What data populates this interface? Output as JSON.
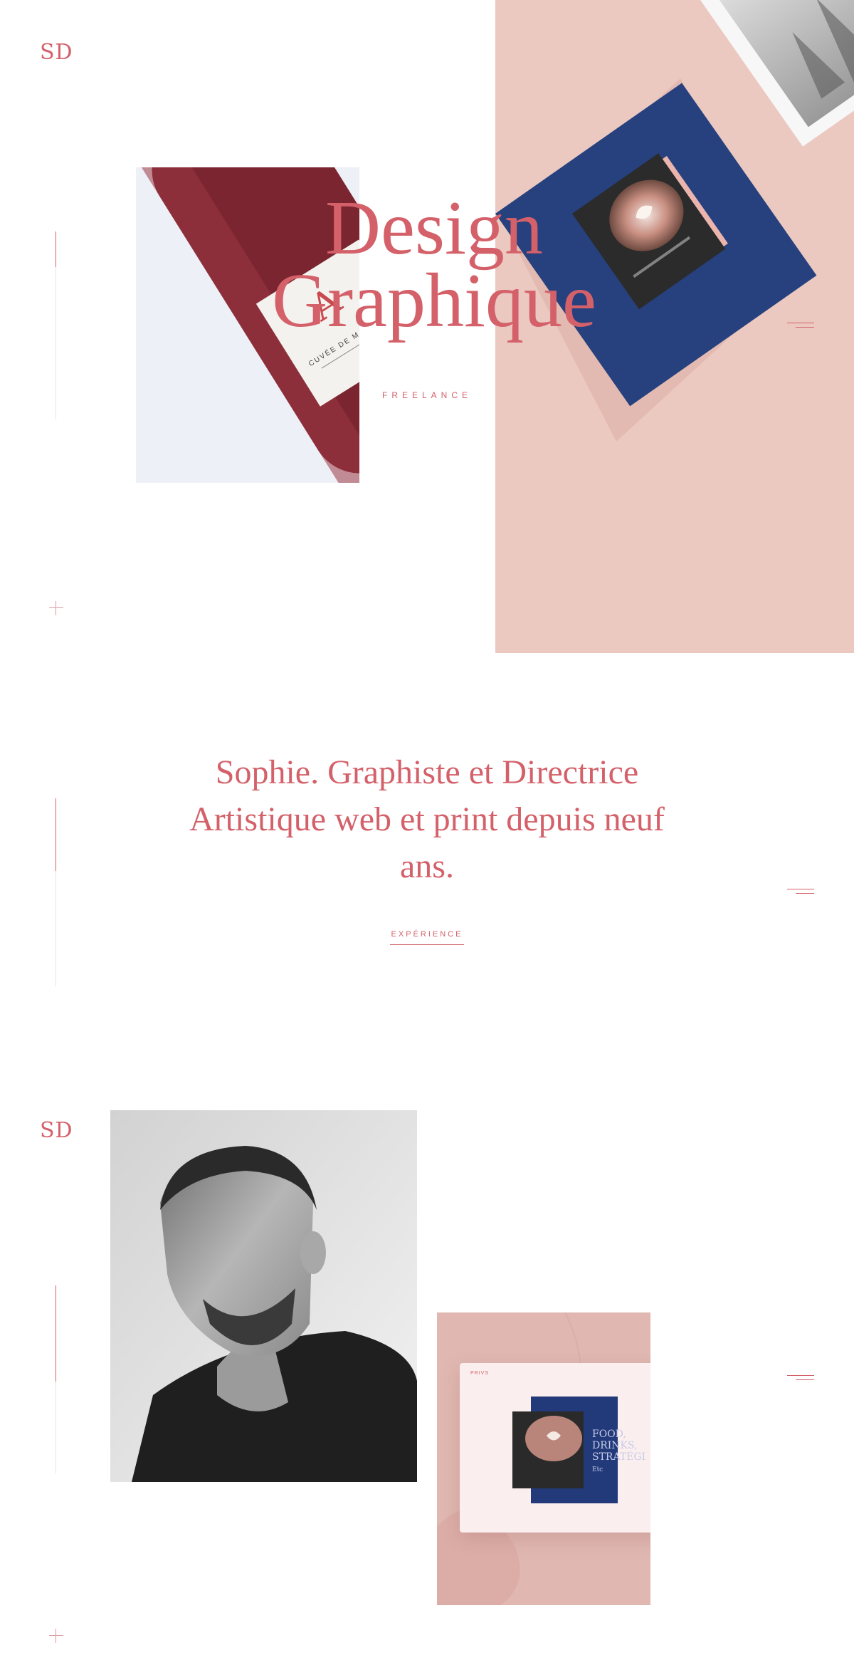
{
  "brand": {
    "logo_text": "SD"
  },
  "hero": {
    "title_line1": "Design",
    "title_line2": "Graphique",
    "subtitle": "FREELANCE",
    "bottle_label": "CUVÉE DE MAGNUM"
  },
  "intro": {
    "text": "Sophie. Graphiste et Directrice Artistique web et print depuis neuf ans.",
    "link_label": "EXPÉRIENCE"
  },
  "showcase": {
    "card_tag": "PRIVS",
    "card_heading": "FOOD,\nDRINKS,\nSTRATÉGI",
    "card_small": "Etc"
  },
  "colors": {
    "accent": "#d4616a",
    "hero_pink": "#ebc9c0",
    "navy": "#233a7a"
  },
  "icons": [
    "menu-icon",
    "plus-icon",
    "logo-monogram"
  ]
}
